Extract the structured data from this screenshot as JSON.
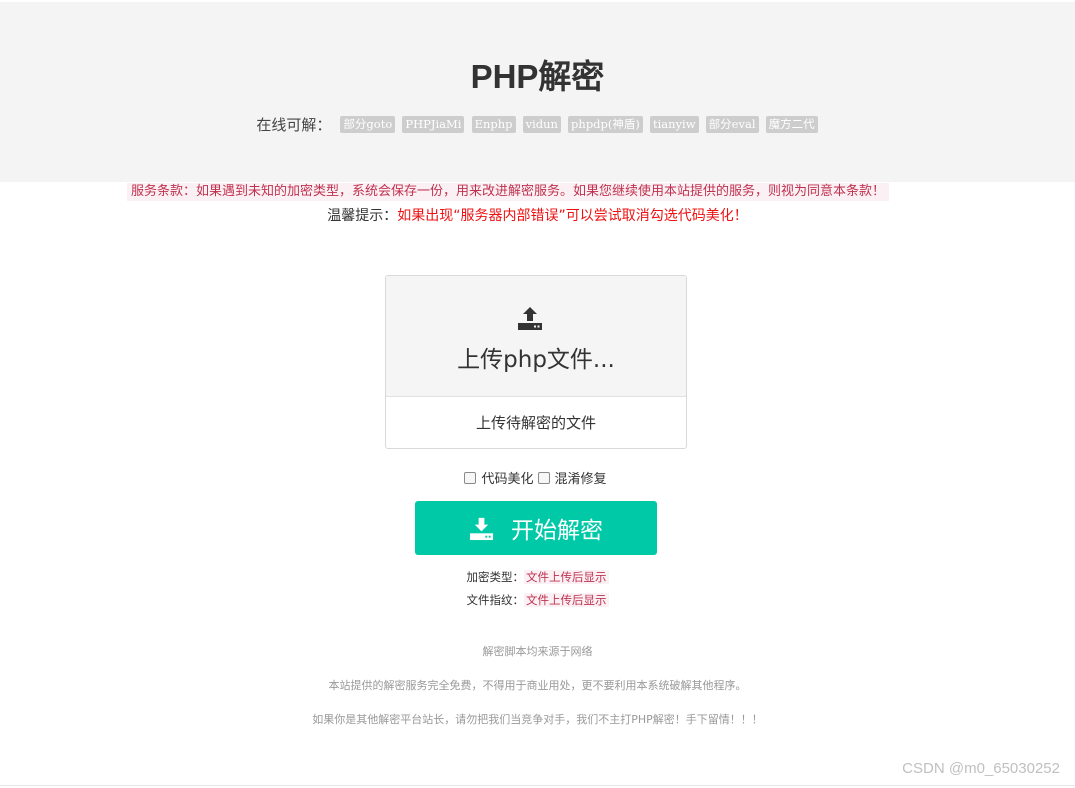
{
  "header": {
    "title": "PHP解密",
    "supported_label": "在线可解：",
    "tags": [
      "部分goto",
      "PHPJiaMi",
      "Enphp",
      "vidun",
      "phpdp(神盾)",
      "tianyiw",
      "部分eval",
      "魔方二代"
    ]
  },
  "notice": {
    "terms": "服务条款：如果遇到未知的加密类型，系统会保存一份，用来改进解密服务。如果您继续使用本站提供的服务，则视为同意本条款！",
    "hint_label": "温馨提示：",
    "hint_text": "如果出现“服务器内部错误”可以尝试取消勾选代码美化！"
  },
  "upload": {
    "icon": "upload-icon",
    "title": "上传php文件...",
    "description": "上传待解密的文件"
  },
  "options": {
    "beautify_label": "代码美化",
    "beautify_checked": false,
    "deobfuscate_label": "混淆修复",
    "deobfuscate_checked": false
  },
  "start_button": {
    "icon": "download-icon",
    "label": "开始解密"
  },
  "info": {
    "type_label": "加密类型：",
    "type_value": "文件上传后显示",
    "fingerprint_label": "文件指纹：",
    "fingerprint_value": "文件上传后显示"
  },
  "footer": {
    "line1": "解密脚本均来源于网络",
    "line2": "本站提供的解密服务完全免费，不得用于商业用处，更不要利用本系统破解其他程序。",
    "line3": "如果你是其他解密平台站长，请勿把我们当竞争对手，我们不主打PHP解密！手下留情！！！"
  },
  "watermark": "CSDN @m0_65030252",
  "colors": {
    "accent": "#00c9a7",
    "warning_red": "#ee1111",
    "terms_text": "#c0314f",
    "tag_bg": "#cdcdcd",
    "hero_bg": "#f4f4f4"
  }
}
